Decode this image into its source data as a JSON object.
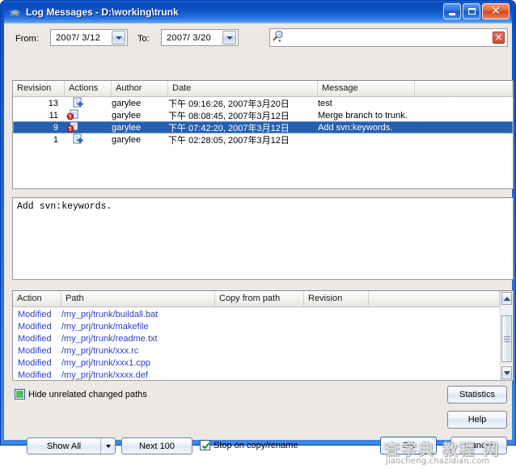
{
  "window": {
    "title": "Log Messages - D:\\working\\trunk",
    "icon": "turtle-icon",
    "minimize_label": "",
    "maximize_label": "",
    "close_label": "✕"
  },
  "filter": {
    "from_label": "From:",
    "from_value": "2007/ 3/12",
    "to_label": "To:",
    "to_value": "2007/ 3/20",
    "search_value": "",
    "search_placeholder": "",
    "search_icon": "magnifier-icon",
    "clear_label": "✕"
  },
  "log_list": {
    "columns": [
      "Revision",
      "Actions",
      "Author",
      "Date",
      "Message"
    ],
    "rows": [
      {
        "revision": "13",
        "action_icon": "file-added-icon",
        "author": "garylee",
        "date": "下午 09:16:26, 2007年3月20日",
        "message": "test",
        "selected": false
      },
      {
        "revision": "11",
        "action_icon": "file-modified-icon",
        "author": "garylee",
        "date": "下午 08:08:45, 2007年3月12日",
        "message": "Merge branch to trunk.",
        "selected": false
      },
      {
        "revision": "9",
        "action_icon": "file-modified-icon",
        "author": "garylee",
        "date": "下午 07:42:20, 2007年3月12日",
        "message": "Add svn:keywords.",
        "selected": true
      },
      {
        "revision": "1",
        "action_icon": "file-added-icon",
        "author": "garylee",
        "date": "下午 02:28:05, 2007年3月12日",
        "message": "",
        "selected": false
      }
    ]
  },
  "message_pane": {
    "text": "Add svn:keywords."
  },
  "paths_list": {
    "columns": [
      "Action",
      "Path",
      "Copy from path",
      "Revision"
    ],
    "rows": [
      {
        "action": "Modified",
        "path": "/my_prj/trunk/buildall.bat",
        "copy_from_path": "",
        "revision": ""
      },
      {
        "action": "Modified",
        "path": "/my_prj/trunk/makefile",
        "copy_from_path": "",
        "revision": ""
      },
      {
        "action": "Modified",
        "path": "/my_prj/trunk/readme.txt",
        "copy_from_path": "",
        "revision": ""
      },
      {
        "action": "Modified",
        "path": "/my_prj/trunk/xxx.rc",
        "copy_from_path": "",
        "revision": ""
      },
      {
        "action": "Modified",
        "path": "/my_prj/trunk/xxx1.cpp",
        "copy_from_path": "",
        "revision": ""
      },
      {
        "action": "Modified",
        "path": "/my_prj/trunk/xxxx.def",
        "copy_from_path": "",
        "revision": ""
      }
    ]
  },
  "options": {
    "hide_unrelated_label": "Hide unrelated changed paths",
    "hide_unrelated_state": "indeterminate",
    "stop_on_copy_label": "Stop on copy/rename",
    "stop_on_copy_state": "checked"
  },
  "buttons": {
    "statistics": "Statistics",
    "statistics_mnemonic": "a",
    "help": "Help",
    "help_mnemonic": "H",
    "show_all": "Show All",
    "show_all_mnemonic": "A",
    "next_100": "Next 100",
    "next_100_mnemonic": "N",
    "ok": "OK",
    "ok_mnemonic": "O",
    "cancel": "Cancel"
  },
  "watermark": {
    "text_cn": "查字典  教程  网",
    "url": "jiaocheng.chazidian.com"
  },
  "colors": {
    "title_blue": "#0a49bb",
    "selection_blue": "#255fb0",
    "path_text_blue": "#2b40c8",
    "dialog_gray": "#ece9e4",
    "check_green": "#5cb85c"
  }
}
